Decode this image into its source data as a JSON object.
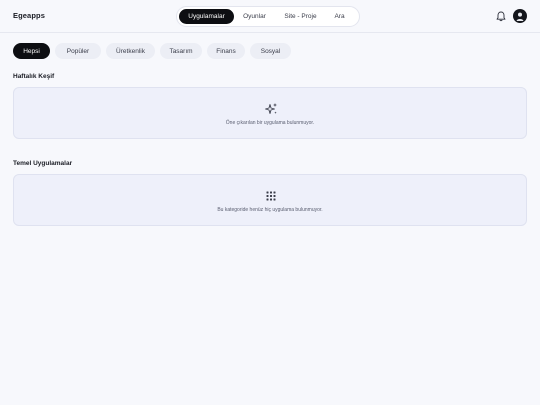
{
  "app": {
    "title": "Egeapps"
  },
  "nav": {
    "items": [
      {
        "label": "Uygulamalar",
        "active": true
      },
      {
        "label": "Oyunlar",
        "active": false
      },
      {
        "label": "Site - Proje",
        "active": false
      },
      {
        "label": "Ara",
        "active": false
      }
    ]
  },
  "filters": {
    "items": [
      {
        "label": "Hepsi",
        "active": true
      },
      {
        "label": "Popüler",
        "active": false
      },
      {
        "label": "Üretkenlik",
        "active": false
      },
      {
        "label": "Tasarım",
        "active": false
      },
      {
        "label": "Finans",
        "active": false
      },
      {
        "label": "Sosyal",
        "active": false
      }
    ]
  },
  "sections": {
    "weekly": {
      "title": "Haftalık Keşif",
      "empty_text": "Öne çıkarılan bir uygulama bulunmuyor.",
      "icon": "sparkles-icon"
    },
    "core": {
      "title": "Temel Uygulamalar",
      "empty_text": "Bu kategoride henüz hiç uygulama bulunmuyor.",
      "icon": "grid-icon"
    }
  },
  "colors": {
    "background": "#f7f8fc",
    "accent": "#0d0e12",
    "card": "#eef0fa"
  }
}
